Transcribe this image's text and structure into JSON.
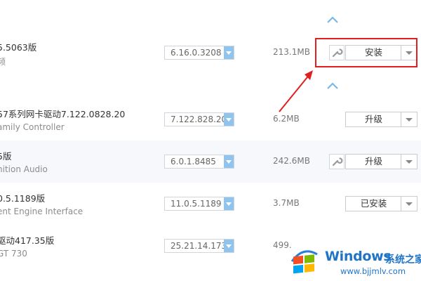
{
  "drivers": [
    {
      "title": "5.5063版",
      "subtitle": "频",
      "version": "6.16.0.3208",
      "size": "213.1MB",
      "action": "安装",
      "has_wrench": true
    },
    {
      "title": "57系列网卡驱动7.122.0828.20",
      "subtitle": "amily Controller",
      "version": "7.122.828.20",
      "size": "6.2MB",
      "action": "升级",
      "has_wrench": false
    },
    {
      "title": "5版",
      "subtitle": "nition Audio",
      "version": "6.0.1.8485",
      "size": "242.6MB",
      "action": "升级",
      "has_wrench": true
    },
    {
      "title": "0.5.1189版",
      "subtitle": "ent Engine Interface",
      "version": "11.0.5.1189",
      "size": "3.7MB",
      "action": "已安装",
      "has_wrench": false
    },
    {
      "title": "驱动417.35版",
      "subtitle": "GT 730",
      "version": "25.21.14.173",
      "size": "499.",
      "action": "",
      "has_wrench": false
    }
  ],
  "colors": {
    "accent_blue": "#5aa7e6",
    "highlight_red": "#e02020",
    "row_alt_bg": "#f6f8fb"
  },
  "icons": [
    "wrench-icon",
    "chevron-down-icon",
    "collapse-up-icon",
    "annotation-arrow",
    "windows-logo"
  ],
  "watermark": {
    "brand": "Windows",
    "brand_cn": "系统之家",
    "url": "www.bjjmlv.com"
  }
}
